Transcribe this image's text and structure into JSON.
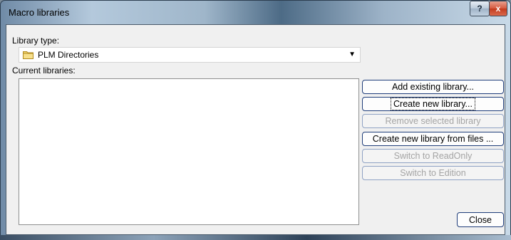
{
  "window": {
    "title": "Macro libraries",
    "help_symbol": "?",
    "close_symbol": "x"
  },
  "library_type": {
    "label": "Library type:",
    "selected": "PLM Directories",
    "icon": "folder-icon"
  },
  "current_libraries": {
    "label": "Current libraries:",
    "items": []
  },
  "buttons": {
    "add_existing": "Add existing library...",
    "create_new": "Create new library...",
    "remove_selected": "Remove selected library",
    "create_from_files": "Create new library from files ...",
    "switch_readonly": "Switch to ReadOnly",
    "switch_edition": "Switch to Edition",
    "close": "Close"
  }
}
